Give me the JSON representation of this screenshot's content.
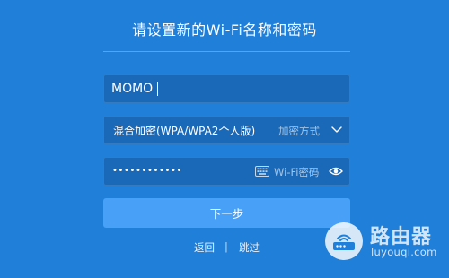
{
  "page": {
    "title": "请设置新的Wi-Fi名称和密码"
  },
  "ssid": {
    "value": "MOMO"
  },
  "encryption": {
    "selected": "混合加密(WPA/WPA2个人版)",
    "hint": "加密方式"
  },
  "password": {
    "masked": "••••••••••••",
    "placeholder": "Wi-Fi密码"
  },
  "actions": {
    "next_label": "下一步",
    "back_label": "返回",
    "separator": "|",
    "skip_label": "跳过"
  },
  "watermark": {
    "cn": "路由器",
    "url": "luyouqi.com"
  },
  "colors": {
    "background": "#1f7fd9",
    "field": "#1a69b8",
    "button": "#48a0f7"
  }
}
